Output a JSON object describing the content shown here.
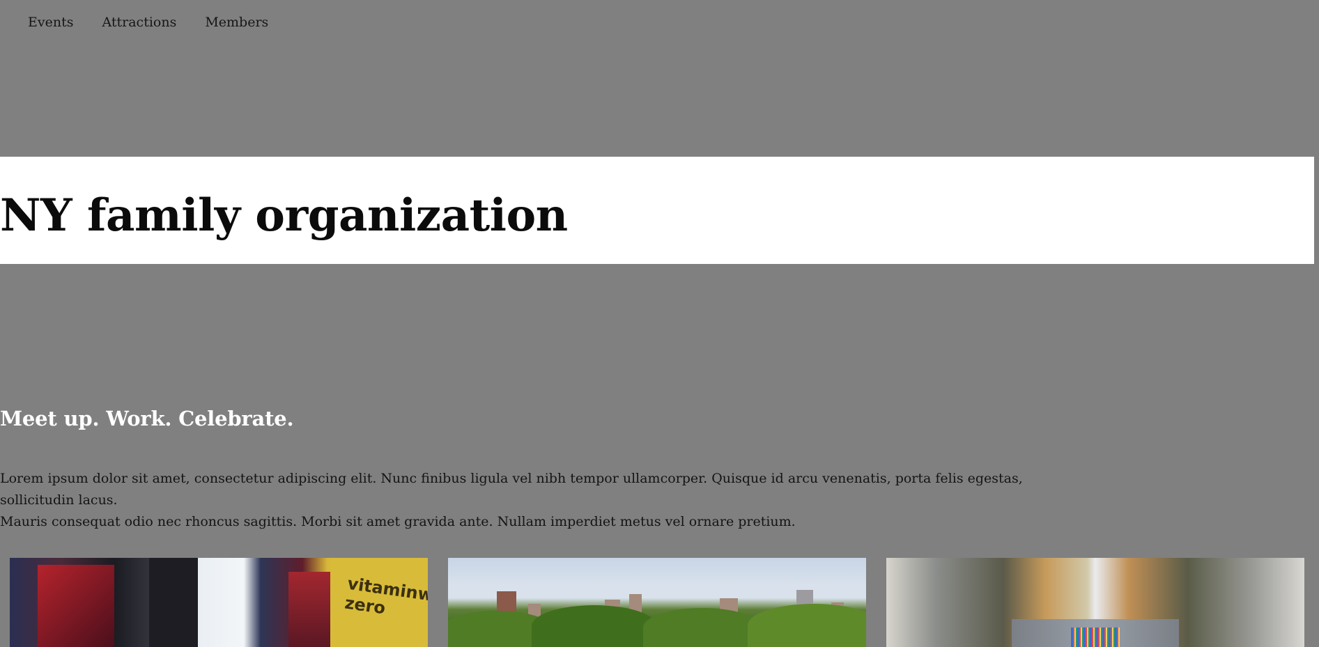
{
  "nav": {
    "items": [
      "Events",
      "Attractions",
      "Members"
    ]
  },
  "hero": {
    "title": "NY family organization"
  },
  "section": {
    "tagline": "Meet up. Work. Celebrate.",
    "intro_line1": "Lorem ipsum dolor sit amet, consectetur adipiscing elit. Nunc finibus ligula vel nibh tempor ullamcorper. Quisque id arcu venenatis, porta felis egestas, sollicitudin lacus.",
    "intro_line2": "Mauris consequat odio nec rhoncus sagittis. Morbi sit amet gravida ante. Nullam imperdiet metus vel ornare pretium."
  },
  "gallery": {
    "photo1_sign": "vitaminwater zero"
  }
}
